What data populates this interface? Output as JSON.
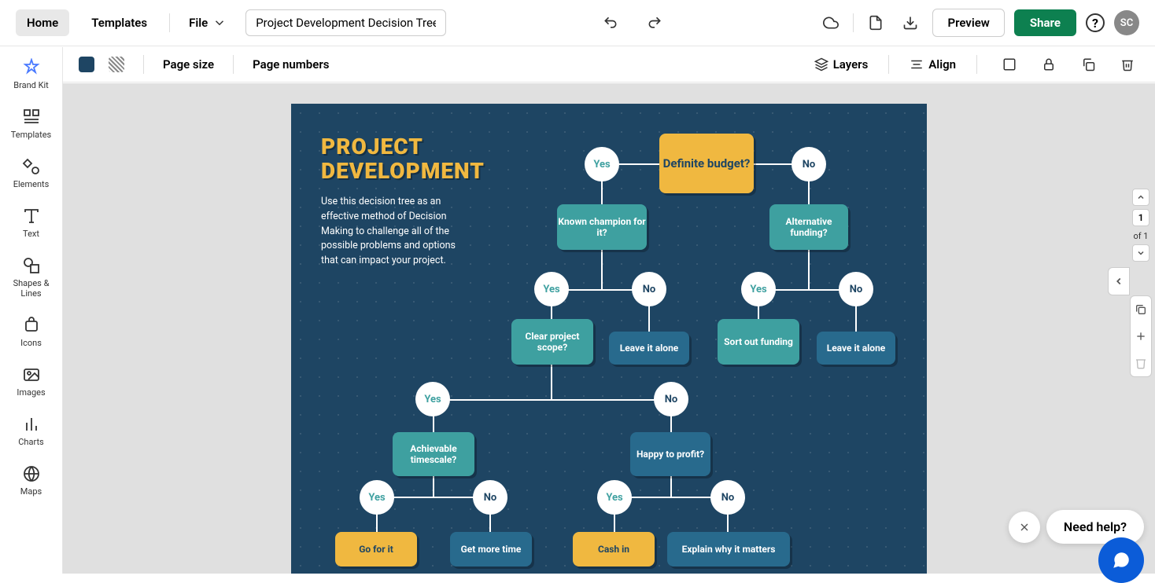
{
  "header": {
    "tabs": {
      "home": "Home",
      "templates": "Templates"
    },
    "file_label": "File",
    "title": "Project Development Decision Tree",
    "preview": "Preview",
    "share": "Share",
    "avatar": "SC"
  },
  "toolbar2": {
    "page_size": "Page size",
    "page_numbers": "Page numbers",
    "layers": "Layers",
    "align": "Align",
    "swatch_color": "#1e4563"
  },
  "sidebar": {
    "brand_kit": "Brand Kit",
    "templates": "Templates",
    "elements": "Elements",
    "text": "Text",
    "shapes_lines": "Shapes & Lines",
    "icons": "Icons",
    "images": "Images",
    "charts": "Charts",
    "maps": "Maps"
  },
  "page_nav": {
    "current": "1",
    "of_label": "of 1"
  },
  "help": {
    "label": "Need help?"
  },
  "tree": {
    "title_line1": "PROJECT",
    "title_line2": "DEVELOPMENT",
    "description": "Use this decision tree as an effective method of Decision Making to challenge all of the possible problems and options that can impact your project.",
    "nodes": {
      "definite_budget": "Definite budget?",
      "known_champion": "Known champion for it?",
      "alternative_funding": "Alternative funding?",
      "clear_scope": "Clear project scope?",
      "leave_alone_1": "Leave it alone",
      "sort_funding": "Sort out funding",
      "leave_alone_2": "Leave it alone",
      "achievable_timescale": "Achievable timescale?",
      "happy_profit": "Happy to profit?",
      "go_for_it": "Go for it",
      "get_more_time": "Get more time",
      "cash_in": "Cash in",
      "explain_matters": "Explain why it matters"
    },
    "labels": {
      "yes": "Yes",
      "no": "No"
    }
  }
}
